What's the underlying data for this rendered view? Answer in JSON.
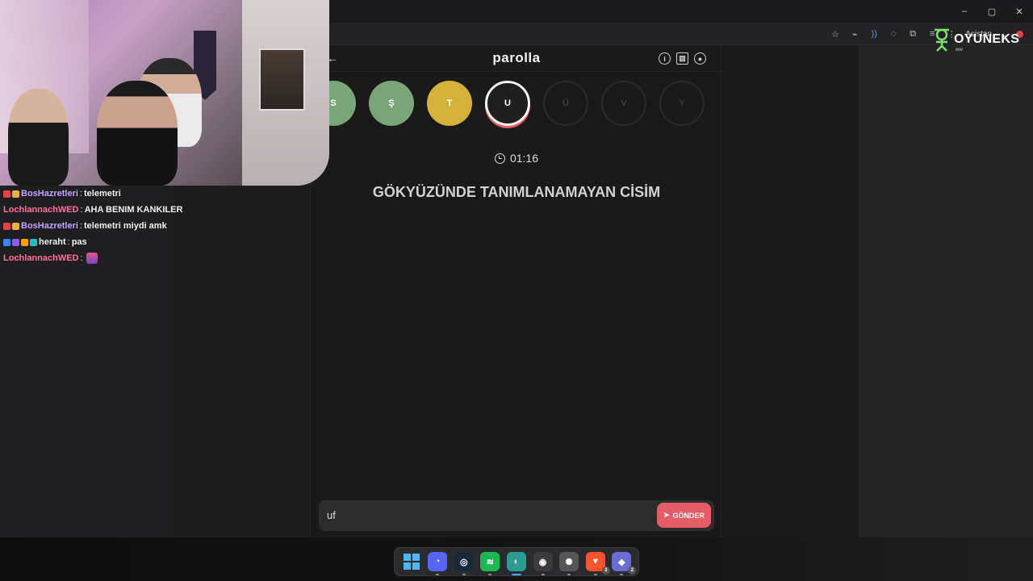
{
  "window": {
    "controls": [
      "–",
      "▢",
      "✕"
    ]
  },
  "toolbar": {
    "asistan_label": "Asistan"
  },
  "logo": {
    "text": "OYUNEKS",
    "sub": "ww"
  },
  "game": {
    "title": "parolla",
    "back_glyph": "←",
    "letters": [
      {
        "char": "S",
        "state": "done"
      },
      {
        "char": "Ş",
        "state": "done"
      },
      {
        "char": "T",
        "state": "partial"
      },
      {
        "char": "U",
        "state": "active"
      },
      {
        "char": "Ü",
        "state": "pending"
      },
      {
        "char": "V",
        "state": "pending"
      },
      {
        "char": "Y",
        "state": "pending"
      }
    ],
    "timer": "01:16",
    "question": "GÖKYÜZÜNDE TANIMLANAMAYAN CİSİM",
    "answer_value": "uf",
    "send_label": "GÖNDER"
  },
  "chat": [
    {
      "user": "BosHazretleri",
      "color": "#c9a0ff",
      "sep": ":",
      "msg": "telemetri",
      "badges": [
        "#e0414a",
        "#e8b23a"
      ]
    },
    {
      "user": "LochlannachWED",
      "color": "#ff6f9a",
      "sep": ":",
      "msg": "AHA BENIM KANKILER",
      "badges": []
    },
    {
      "user": "BosHazretleri",
      "color": "#c9a0ff",
      "sep": ":",
      "msg": "telemetri miydi amk",
      "badges": [
        "#e0414a",
        "#e8b23a"
      ]
    },
    {
      "user": "heraht",
      "color": "#f0f0f0",
      "sep": ":",
      "msg": "pas",
      "badges": [
        "#3b82f6",
        "#8b5cf6",
        "#f59e0b",
        "#22c1c3"
      ]
    },
    {
      "user": "LochlannachWED",
      "color": "#ff6f9a",
      "sep": ":",
      "msg": "",
      "badges": [],
      "emote": true
    }
  ],
  "taskbar": {
    "apps": [
      {
        "name": "start",
        "color": "#2b7fd6"
      },
      {
        "name": "discord",
        "color": "#5865f2",
        "glyph": "◔"
      },
      {
        "name": "steam",
        "color": "#1b2838",
        "glyph": "◎"
      },
      {
        "name": "spotify",
        "color": "#1db954",
        "glyph": "≋"
      },
      {
        "name": "browser-active",
        "color": "#2a9d8f",
        "glyph": "◐"
      },
      {
        "name": "obs",
        "color": "#3b3b3b",
        "glyph": "◉"
      },
      {
        "name": "steelseries",
        "color": "#555555",
        "glyph": "✺"
      },
      {
        "name": "brave",
        "color": "#fb542b",
        "glyph": "▼",
        "count": "3"
      },
      {
        "name": "launcher",
        "color": "#6b6bd6",
        "glyph": "◆",
        "count": "2"
      }
    ]
  }
}
